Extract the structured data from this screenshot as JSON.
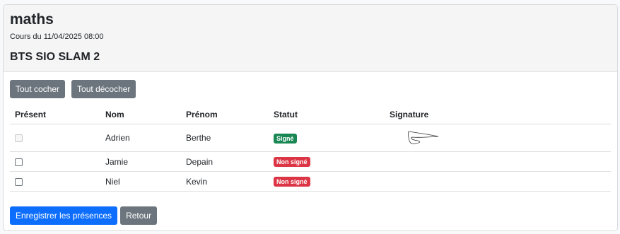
{
  "header": {
    "title": "maths",
    "subtitle": "Cours du 11/04/2025 08:00",
    "class_name": "BTS SIO SLAM 2"
  },
  "toolbar": {
    "check_all": "Tout cocher",
    "uncheck_all": "Tout décocher"
  },
  "table": {
    "columns": [
      "Présent",
      "Nom",
      "Prénom",
      "Statut",
      "Signature"
    ],
    "rows": [
      {
        "present": false,
        "disabled": true,
        "nom": "Adrien",
        "prenom": "Berthe",
        "statut": "Signé",
        "has_signature": true
      },
      {
        "present": false,
        "disabled": false,
        "nom": "Jamie",
        "prenom": "Depain",
        "statut": "Non signé",
        "has_signature": false
      },
      {
        "present": false,
        "disabled": false,
        "nom": "Niel",
        "prenom": "Kevin",
        "statut": "Non signé",
        "has_signature": false
      }
    ]
  },
  "footer": {
    "save": "Enregistrer les présences",
    "back": "Retour"
  },
  "colors": {
    "signed": "#198754",
    "unsigned": "#dc3545",
    "primary": "#0d6efd",
    "secondary": "#6c757d"
  }
}
